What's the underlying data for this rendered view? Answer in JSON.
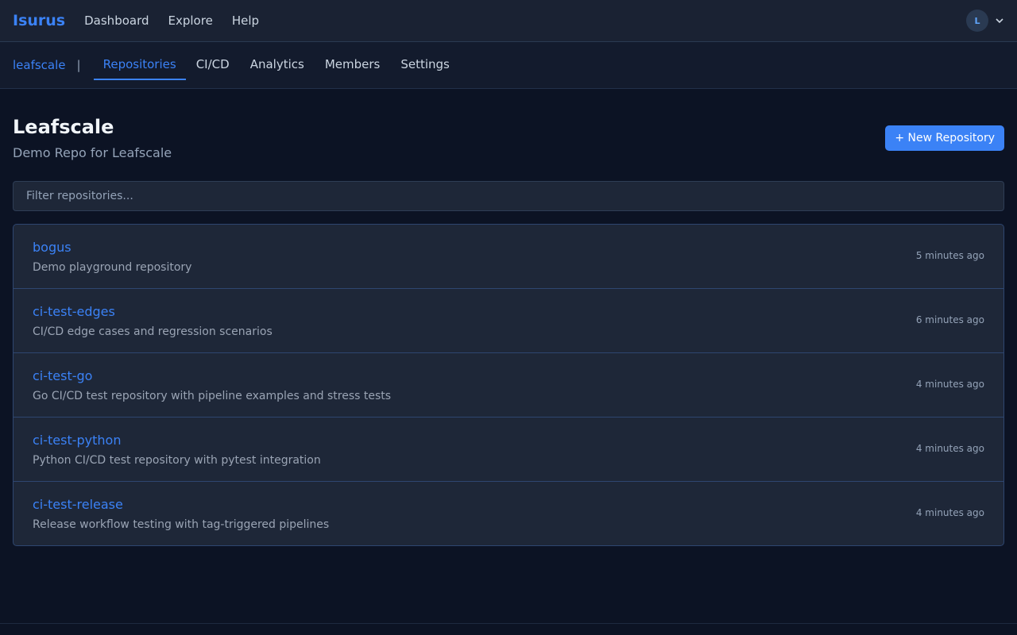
{
  "header": {
    "brand": "Isurus",
    "nav": [
      "Dashboard",
      "Explore",
      "Help"
    ],
    "avatar_initial": "L"
  },
  "subnav": {
    "org": "leafscale",
    "separator": "|",
    "tabs": [
      "Repositories",
      "CI/CD",
      "Analytics",
      "Members",
      "Settings"
    ],
    "active_tab": "Repositories"
  },
  "page": {
    "title": "Leafscale",
    "subtitle": "Demo Repo for Leafscale",
    "new_button": "+ New Repository",
    "filter_placeholder": "Filter repositories..."
  },
  "repos": [
    {
      "name": "bogus",
      "description": "Demo playground repository",
      "updated": "5 minutes ago"
    },
    {
      "name": "ci-test-edges",
      "description": "CI/CD edge cases and regression scenarios",
      "updated": "6 minutes ago"
    },
    {
      "name": "ci-test-go",
      "description": "Go CI/CD test repository with pipeline examples and stress tests",
      "updated": "4 minutes ago"
    },
    {
      "name": "ci-test-python",
      "description": "Python CI/CD test repository with pytest integration",
      "updated": "4 minutes ago"
    },
    {
      "name": "ci-test-release",
      "description": "Release workflow testing with tag-triggered pipelines",
      "updated": "4 minutes ago"
    }
  ],
  "colors": {
    "accent": "#3b82f6",
    "background": "#0c1324",
    "surface": "#1e2738"
  }
}
